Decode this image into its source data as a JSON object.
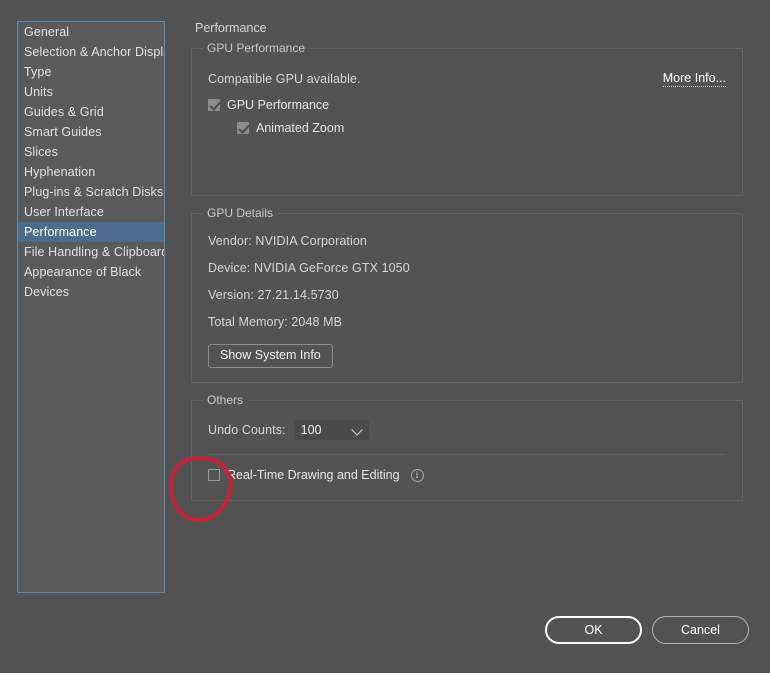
{
  "sidebar": {
    "items": [
      {
        "label": "General",
        "selected": false
      },
      {
        "label": "Selection & Anchor Display",
        "selected": false
      },
      {
        "label": "Type",
        "selected": false
      },
      {
        "label": "Units",
        "selected": false
      },
      {
        "label": "Guides & Grid",
        "selected": false
      },
      {
        "label": "Smart Guides",
        "selected": false
      },
      {
        "label": "Slices",
        "selected": false
      },
      {
        "label": "Hyphenation",
        "selected": false
      },
      {
        "label": "Plug-ins & Scratch Disks",
        "selected": false
      },
      {
        "label": "User Interface",
        "selected": false
      },
      {
        "label": "Performance",
        "selected": true
      },
      {
        "label": "File Handling & Clipboard",
        "selected": false
      },
      {
        "label": "Appearance of Black",
        "selected": false
      },
      {
        "label": "Devices",
        "selected": false
      }
    ]
  },
  "pane": {
    "title": "Performance",
    "gpu_performance": {
      "group_label": "GPU Performance",
      "status_text": "Compatible GPU available.",
      "more_info_label": "More Info...",
      "checkboxes": [
        {
          "label": "GPU Performance",
          "checked": true
        },
        {
          "label": "Animated Zoom",
          "checked": true
        }
      ]
    },
    "gpu_details": {
      "group_label": "GPU Details",
      "lines": [
        "Vendor: NVIDIA Corporation",
        "Device: NVIDIA GeForce GTX 1050",
        "Version: 27.21.14.5730",
        "Total Memory: 2048 MB"
      ],
      "show_system_info_label": "Show System Info"
    },
    "others": {
      "group_label": "Others",
      "undo_counts_label": "Undo Counts:",
      "undo_counts_value": "100",
      "realtime_checkbox": {
        "label": "Real-Time Drawing and Editing",
        "checked": false
      },
      "info_icon_glyph": "i"
    }
  },
  "footer": {
    "ok_label": "OK",
    "cancel_label": "Cancel"
  },
  "annotation": {
    "shape": "hand-drawn-ellipse",
    "color": "#c0253a",
    "targets": "real-time-drawing-and-editing-checkbox"
  },
  "colors": {
    "window_background": "#535353",
    "sidebar_background": "#5a5a5a",
    "sidebar_border": "#5b8ab5",
    "selection": "#4c6c8e",
    "group_border": "#636363",
    "text": "#d8d8d8",
    "annotation_red": "#c0253a"
  }
}
